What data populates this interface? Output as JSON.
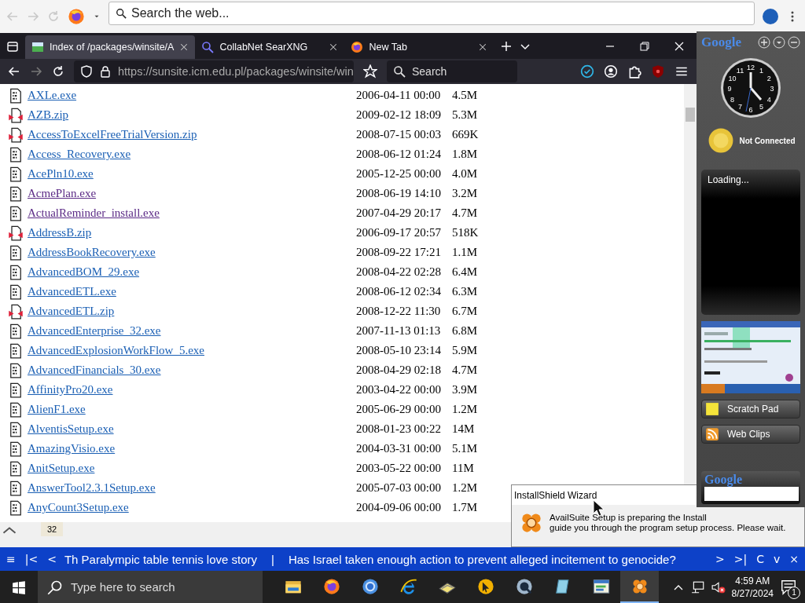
{
  "top_bar": {
    "search": {
      "placeholder": "Search the web..."
    }
  },
  "browser": {
    "tabs": [
      {
        "label": "Index of /packages/winsite/A",
        "selected": true
      },
      {
        "label": "CollabNet SearXNG",
        "selected": false
      },
      {
        "label": "New Tab",
        "selected": false
      }
    ],
    "address": "https://sunsite.icm.edu.pl/packages/winsite/win",
    "search": {
      "placeholder": "Search"
    },
    "files": [
      {
        "name": "AXLe.exe",
        "kind": "exe",
        "visited": false,
        "date": "2006-04-11 00:00",
        "size": "4.5M"
      },
      {
        "name": "AZB.zip",
        "kind": "zip",
        "visited": false,
        "date": "2009-02-12 18:09",
        "size": "5.3M"
      },
      {
        "name": "AccessToExcelFreeTrialVersion.zip",
        "kind": "zip",
        "visited": false,
        "date": "2008-07-15 00:03",
        "size": "669K"
      },
      {
        "name": "Access_Recovery.exe",
        "kind": "exe",
        "visited": false,
        "date": "2008-06-12 01:24",
        "size": "1.8M"
      },
      {
        "name": "AcePln10.exe",
        "kind": "exe",
        "visited": false,
        "date": "2005-12-25 00:00",
        "size": "4.0M"
      },
      {
        "name": "AcmePlan.exe",
        "kind": "exe",
        "visited": true,
        "date": "2008-06-19 14:10",
        "size": "3.2M"
      },
      {
        "name": "ActualReminder_install.exe",
        "kind": "exe",
        "visited": true,
        "date": "2007-04-29 20:17",
        "size": "4.7M"
      },
      {
        "name": "AddressB.zip",
        "kind": "zip",
        "visited": false,
        "date": "2006-09-17 20:57",
        "size": "518K"
      },
      {
        "name": "AddressBookRecovery.exe",
        "kind": "exe",
        "visited": false,
        "date": "2008-09-22 17:21",
        "size": "1.1M"
      },
      {
        "name": "AdvancedBOM_29.exe",
        "kind": "exe",
        "visited": false,
        "date": "2008-04-22 02:28",
        "size": "6.4M"
      },
      {
        "name": "AdvancedETL.exe",
        "kind": "exe",
        "visited": false,
        "date": "2008-06-12 02:34",
        "size": "6.3M"
      },
      {
        "name": "AdvancedETL.zip",
        "kind": "zip",
        "visited": false,
        "date": "2008-12-22 11:30",
        "size": "6.7M"
      },
      {
        "name": "AdvancedEnterprise_32.exe",
        "kind": "exe",
        "visited": false,
        "date": "2007-11-13 01:13",
        "size": "6.8M"
      },
      {
        "name": "AdvancedExplosionWorkFlow_5.exe",
        "kind": "exe",
        "visited": false,
        "date": "2008-05-10 23:14",
        "size": "5.9M"
      },
      {
        "name": "AdvancedFinancials_30.exe",
        "kind": "exe",
        "visited": false,
        "date": "2008-04-29 02:18",
        "size": "4.7M"
      },
      {
        "name": "AffinityPro20.exe",
        "kind": "exe",
        "visited": false,
        "date": "2003-04-22 00:00",
        "size": "3.9M"
      },
      {
        "name": "AlienF1.exe",
        "kind": "exe",
        "visited": false,
        "date": "2005-06-29 00:00",
        "size": "1.2M"
      },
      {
        "name": "AlventisSetup.exe",
        "kind": "exe",
        "visited": false,
        "date": "2008-01-23 00:22",
        "size": "14M"
      },
      {
        "name": "AmazingVisio.exe",
        "kind": "exe",
        "visited": false,
        "date": "2004-03-31 00:00",
        "size": "5.1M"
      },
      {
        "name": "AnitSetup.exe",
        "kind": "exe",
        "visited": false,
        "date": "2003-05-22 00:00",
        "size": "11M"
      },
      {
        "name": "AnswerTool2.3.1Setup.exe",
        "kind": "exe",
        "visited": false,
        "date": "2005-07-03 00:00",
        "size": "1.2M"
      },
      {
        "name": "AnyCount3Setup.exe",
        "kind": "exe",
        "visited": false,
        "date": "2004-09-06 00:00",
        "size": "1.7M"
      }
    ],
    "background_window": {
      "label": "32"
    }
  },
  "sidebar": {
    "logo": "Google",
    "clock_numerals": [
      "11",
      "12",
      "1",
      "10",
      "2",
      "9",
      "3",
      "8",
      "4",
      "7",
      "5",
      "6"
    ],
    "weather": "Not Connected",
    "panel": "Loading...",
    "buttons": [
      {
        "label": "Scratch Pad",
        "kind": "note"
      },
      {
        "label": "Web Clips",
        "kind": "rss"
      }
    ],
    "search_logo": "Google"
  },
  "dialog": {
    "title": "InstallShield Wizard",
    "line_1": "AvailSuite Setup is preparing the Install",
    "line_2": "guide you through the program setup process.  Please wait."
  },
  "ticker": {
    "left_controls": [
      "≡",
      "|<",
      "<"
    ],
    "headlines": [
      "Th Paralympic table tennis love story",
      "Has Israel taken enough action to prevent alleged incitement to genocide?"
    ],
    "separator": "|",
    "right_controls": [
      ">",
      ">|",
      "C",
      "v",
      "×"
    ]
  },
  "taskbar": {
    "search": {
      "placeholder": "Type here to search"
    },
    "apps": [
      {
        "kind": "folder",
        "active": false
      },
      {
        "kind": "firefox",
        "active": false
      },
      {
        "kind": "chrome",
        "active": false
      },
      {
        "kind": "ie",
        "active": false
      },
      {
        "kind": "book",
        "active": false
      },
      {
        "kind": "pointer",
        "active": false
      },
      {
        "kind": "quicktime",
        "active": false
      },
      {
        "kind": "notepad",
        "active": false
      },
      {
        "kind": "window",
        "active": false
      },
      {
        "kind": "balls",
        "active": true
      }
    ],
    "time": "4:59 AM",
    "date": "8/27/2024",
    "notifications": "1"
  }
}
